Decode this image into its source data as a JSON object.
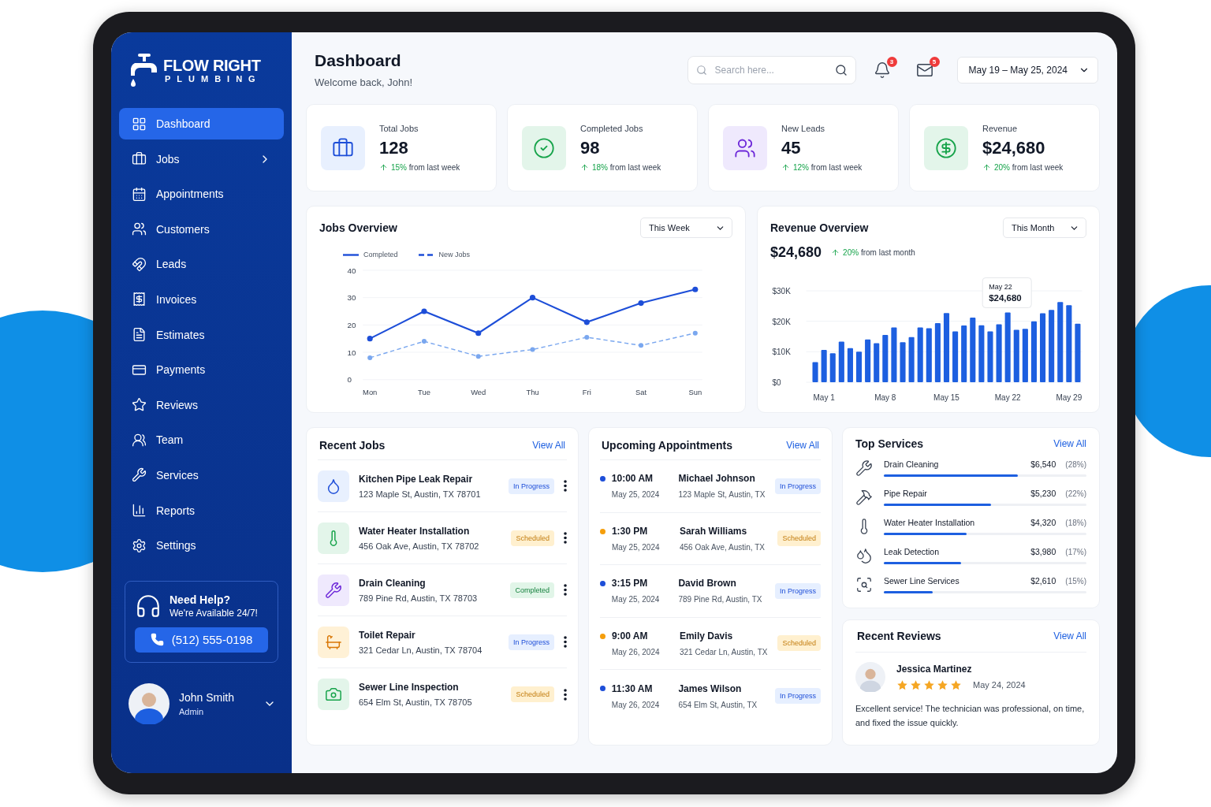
{
  "brand": {
    "name": "FLOW RIGHT",
    "tagline": "PLUMBING"
  },
  "nav": [
    {
      "kind": "dashboard",
      "label": "Dashboard",
      "selected": true,
      "submenu": false
    },
    {
      "kind": "jobs",
      "label": "Jobs",
      "selected": false,
      "submenu": true
    },
    {
      "kind": "appointments",
      "label": "Appointments",
      "selected": false,
      "submenu": false
    },
    {
      "kind": "customers",
      "label": "Customers",
      "selected": false,
      "submenu": false
    },
    {
      "kind": "leads",
      "label": "Leads",
      "selected": false,
      "submenu": false
    },
    {
      "kind": "invoices",
      "label": "Invoices",
      "selected": false,
      "submenu": false
    },
    {
      "kind": "estimates",
      "label": "Estimates",
      "selected": false,
      "submenu": false
    },
    {
      "kind": "payments",
      "label": "Payments",
      "selected": false,
      "submenu": false
    },
    {
      "kind": "reviews",
      "label": "Reviews",
      "selected": false,
      "submenu": false
    },
    {
      "kind": "team",
      "label": "Team",
      "selected": false,
      "submenu": false
    },
    {
      "kind": "services",
      "label": "Services",
      "selected": false,
      "submenu": false
    },
    {
      "kind": "reports",
      "label": "Reports",
      "selected": false,
      "submenu": false
    },
    {
      "kind": "settings",
      "label": "Settings",
      "selected": false,
      "submenu": false
    }
  ],
  "help": {
    "title": "Need Help?",
    "text": "We're Available 24/7!",
    "phone": "(512) 555-0198"
  },
  "user": {
    "name": "John Smith",
    "role": "Admin"
  },
  "header": {
    "title": "Dashboard",
    "subtitle": "Welcome back, John!",
    "search": {
      "placeholder": "Search here..."
    },
    "notifications": "3",
    "messages": "5",
    "date_range": "May 19 – May 25, 2024"
  },
  "stats": [
    {
      "kind": "jobs",
      "label": "Total Jobs",
      "value": "128",
      "change": "15%",
      "note": "from last week"
    },
    {
      "kind": "completed",
      "label": "Completed Jobs",
      "value": "98",
      "change": "18%",
      "note": "from last week"
    },
    {
      "kind": "leads",
      "label": "New Leads",
      "value": "45",
      "change": "12%",
      "note": "from last week"
    },
    {
      "kind": "revenue",
      "label": "Revenue",
      "value": "$24,680",
      "change": "20%",
      "note": "from last week"
    }
  ],
  "jobs_overview": {
    "title": "Jobs Overview",
    "period": "This Week",
    "chart_data": {
      "type": "line",
      "grid": true,
      "categories": [
        "Mon",
        "Tue",
        "Wed",
        "Thu",
        "Fri",
        "Sat",
        "Sun"
      ],
      "ylim": [
        0,
        40
      ],
      "yticks": [
        0,
        10,
        20,
        30,
        40
      ],
      "series": [
        {
          "name": "Completed",
          "color": "#1d4ed8",
          "line_style": "solid",
          "marker": "circle",
          "values": [
            15,
            25,
            17,
            30,
            21,
            28,
            33
          ]
        },
        {
          "name": "New Jobs",
          "color": "#7aa7ef",
          "line_style": "dashed",
          "marker": "circle",
          "values": [
            8,
            14,
            8.5,
            11,
            15.5,
            12.5,
            17
          ]
        }
      ]
    }
  },
  "revenue_overview": {
    "title": "Revenue Overview",
    "period": "This Month",
    "total": "$24,680",
    "change": "20%",
    "note": "from last month",
    "chart_data": {
      "type": "bar",
      "grid": true,
      "categories": [
        null,
        "May 1",
        null,
        null,
        null,
        null,
        null,
        null,
        "May 8",
        null,
        null,
        null,
        null,
        null,
        null,
        "May 15",
        null,
        null,
        null,
        null,
        null,
        null,
        "May 22",
        null,
        null,
        null,
        null,
        null,
        null,
        "May 29",
        null
      ],
      "ylim": [
        0,
        30
      ],
      "yticks": [
        {
          "value": 0,
          "label": "$0"
        },
        {
          "value": 10,
          "label": "$10K"
        },
        {
          "value": 20,
          "label": "$20K"
        },
        {
          "value": 30,
          "label": "$30K"
        }
      ],
      "values": [
        6.6,
        10.6,
        9.5,
        13.3,
        11.2,
        10,
        14,
        12.8,
        15.5,
        18,
        13.1,
        14.8,
        18,
        17.7,
        19.4,
        22.7,
        16.7,
        18.6,
        21.2,
        18.7,
        16.7,
        19,
        22.9,
        17.2,
        17.5,
        20,
        22.6,
        23.7,
        26.3,
        25.3,
        19.2
      ],
      "annotations": [
        {
          "x": "May 22",
          "y": 22.9,
          "text": "May 22\n$24,680"
        }
      ]
    }
  },
  "recent_jobs": {
    "title": "Recent Jobs",
    "link": "View All",
    "items": [
      {
        "kind": "leak",
        "title": "Kitchen Pipe Leak Repair",
        "address": "123 Maple St, Austin, TX 78701",
        "status": {
          "kind": "in_progress",
          "label": "In Progress"
        }
      },
      {
        "kind": "heater",
        "title": "Water Heater Installation",
        "address": "456 Oak Ave, Austin, TX 78702",
        "status": {
          "kind": "scheduled",
          "label": "Scheduled"
        }
      },
      {
        "kind": "pipe",
        "title": "Drain Cleaning",
        "address": "789 Pine Rd, Austin, TX 78703",
        "status": {
          "kind": "completed",
          "label": "Completed"
        }
      },
      {
        "kind": "toilet",
        "title": "Toilet Repair",
        "address": "321 Cedar Ln, Austin, TX 78704",
        "status": {
          "kind": "in_progress",
          "label": "In Progress"
        }
      },
      {
        "kind": "camera",
        "title": "Sewer Line Inspection",
        "address": "654 Elm St, Austin, TX 78705",
        "status": {
          "kind": "scheduled",
          "label": "Scheduled"
        }
      }
    ]
  },
  "appointments": {
    "title": "Upcoming Appointments",
    "link": "View All",
    "items": [
      {
        "time": "10:00 AM",
        "date": "May 25, 2024",
        "name": "Michael Johnson",
        "address": "123 Maple St, Austin, TX",
        "color": "#1d4ed8",
        "status": {
          "kind": "in_progress",
          "label": "In Progress"
        }
      },
      {
        "time": "1:30 PM",
        "date": "May 25, 2024",
        "name": "Sarah Williams",
        "address": "456 Oak Ave, Austin, TX",
        "color": "#f59e0b",
        "status": {
          "kind": "scheduled",
          "label": "Scheduled"
        }
      },
      {
        "time": "3:15 PM",
        "date": "May 25, 2024",
        "name": "David Brown",
        "address": "789 Pine Rd, Austin, TX",
        "color": "#1d4ed8",
        "status": {
          "kind": "in_progress",
          "label": "In Progress"
        }
      },
      {
        "time": "9:00 AM",
        "date": "May 26, 2024",
        "name": "Emily Davis",
        "address": "321 Cedar Ln, Austin, TX",
        "color": "#f59e0b",
        "status": {
          "kind": "scheduled",
          "label": "Scheduled"
        }
      },
      {
        "time": "11:30 AM",
        "date": "May 26, 2024",
        "name": "James Wilson",
        "address": "654 Elm St, Austin, TX",
        "color": "#1d4ed8",
        "status": {
          "kind": "in_progress",
          "label": "In Progress"
        }
      }
    ]
  },
  "top_services": {
    "title": "Top Services",
    "link": "View All",
    "items": [
      {
        "kind": "drain",
        "name": "Drain Cleaning",
        "amount": "$6,540",
        "share": "(28%)",
        "level": 0.66
      },
      {
        "kind": "pipe",
        "name": "Pipe Repair",
        "amount": "$5,230",
        "share": "(22%)",
        "level": 0.53
      },
      {
        "kind": "heater",
        "name": "Water Heater Installation",
        "amount": "$4,320",
        "share": "(18%)",
        "level": 0.41
      },
      {
        "kind": "leak",
        "name": "Leak Detection",
        "amount": "$3,980",
        "share": "(17%)",
        "level": 0.38
      },
      {
        "kind": "sewer",
        "name": "Sewer Line Services",
        "amount": "$2,610",
        "share": "(15%)",
        "level": 0.24
      }
    ]
  },
  "reviews": {
    "title": "Recent Reviews",
    "link": "View All",
    "items": [
      {
        "name": "Jessica Martinez",
        "stars": 5,
        "date": "May 24, 2024",
        "text": "Excellent service! The technician was professional, on time, and fixed the issue quickly."
      }
    ]
  }
}
